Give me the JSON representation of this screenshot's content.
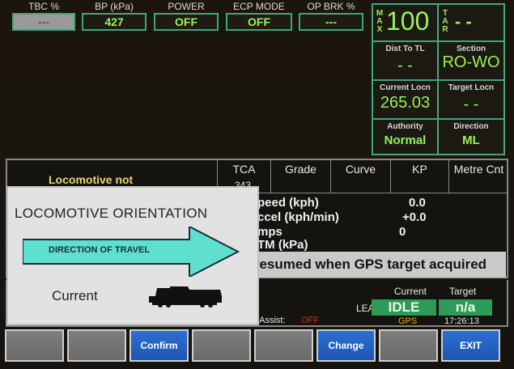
{
  "top": [
    {
      "label": "TBC %",
      "value": "---"
    },
    {
      "label": "BP (kPa)",
      "value": "427"
    },
    {
      "label": "POWER",
      "value": "OFF"
    },
    {
      "label": "ECP MODE",
      "value": "OFF"
    },
    {
      "label": "OP BRK %",
      "value": "---"
    }
  ],
  "panel": {
    "max_letters": [
      "M",
      "A",
      "X"
    ],
    "max_value": "100",
    "tar_letters": [
      "T",
      "A",
      "R"
    ],
    "tar_value": "- -",
    "dist_to_tl_label": "Dist To TL",
    "dist_to_tl_value": "- -",
    "section_label": "Section",
    "section_value": "RO-WO",
    "current_locn_label": "Current Locn",
    "current_locn_value": "265.03",
    "target_locn_label": "Target Locn",
    "target_locn_value": "- -",
    "authority_label": "Authority",
    "authority_value": "Normal",
    "direction_label": "Direction",
    "direction_value": "ML"
  },
  "table": {
    "loco_not": "Locomotive not",
    "headers": [
      "TCA",
      "Grade",
      "Curve",
      "KP",
      "Metre Cnt"
    ],
    "tca_value": "343"
  },
  "params": [
    {
      "label": "peed  (kph)",
      "value": "0.0"
    },
    {
      "label": "ccel  (kph/min)",
      "value": "+0.0"
    },
    {
      "label": "mps",
      "value": "0"
    },
    {
      "label": "TM (kPa)",
      "value": ""
    }
  ],
  "message": "ts resumed when GPS target acquired",
  "status": {
    "current_label": "Current",
    "target_label": "Target",
    "lead_label": "LEAD",
    "idle_value": "IDLE",
    "na_value": "n/a",
    "gps_label": "GPS",
    "time": "17:26:13",
    "assist_label": "r Assist:",
    "assist_value": "OFF"
  },
  "softkeys": [
    "",
    "",
    "Confirm",
    "",
    "",
    "Change",
    "",
    "EXIT"
  ],
  "dialog": {
    "title": "LOCOMOTIVE ORIENTATION",
    "arrow_text": "DIRECTION OF TRAVEL",
    "current_label": "Current"
  },
  "colors": {
    "green_text": "#9cf25a",
    "border_green": "#3fa77a",
    "button_blue": "#1d56b3",
    "status_green": "#2e9a58",
    "arrow_fill": "#5fe0cf"
  }
}
